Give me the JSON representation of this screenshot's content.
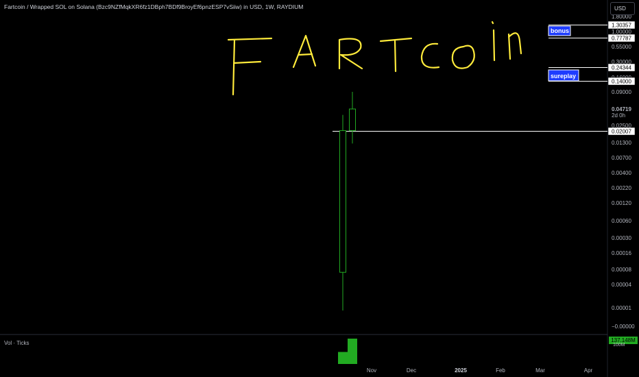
{
  "header": {
    "title": "Fartcoin / Wrapped SOL on Solana (Bzc9NZfMqkXR6fz1DBph7BDf9BroyEf6pnzESP7vSiiw) in USD, 1W, RAYDIUM",
    "currency": "USD"
  },
  "annotation": {
    "handwritten_text": "FARTCOIN",
    "color": "#ffeb3b"
  },
  "price_scale": {
    "ticks": [
      "1.80000",
      "1.00000",
      "0.55000",
      "0.30000",
      "0.16000",
      "0.09000",
      "0.04719",
      "0.02500",
      "0.01300",
      "0.00700",
      "0.00400",
      "0.00220",
      "0.00120",
      "0.00060",
      "0.00030",
      "0.00016",
      "0.00008",
      "0.00004",
      "0.00001",
      "−0.00000"
    ],
    "countdown": "2d 0h"
  },
  "price_tags": [
    {
      "label": "1.30357"
    },
    {
      "label": "0.77787"
    },
    {
      "label": "0.24344"
    },
    {
      "label": "0.14000"
    },
    {
      "label": "0.02007"
    }
  ],
  "badges": [
    {
      "label": "bonus"
    },
    {
      "label": "sureplay"
    }
  ],
  "time_axis": [
    "Nov",
    "Dec",
    "2025",
    "Feb",
    "Mar",
    "Apr"
  ],
  "volume": {
    "label": "Vol · Ticks",
    "value_tag": "137.148M",
    "unit": "100M"
  },
  "colors": {
    "up": "#22ab22",
    "badge_bg": "#1e3cff",
    "line": "#ffffff"
  },
  "chart_data": {
    "type": "candlestick",
    "title": "Fartcoin / Wrapped SOL on Solana (Bzc9NZfMqkXR6fz1DBph7BDf9BroyEf6pnzESP7vSiiw) in USD, 1W, RAYDIUM",
    "y_scale": "log",
    "candles": [
      {
        "open": 7e-05,
        "high": 0.0375,
        "low": 8.5e-06,
        "close": 0.0205
      },
      {
        "open": 0.0205,
        "high": 0.09,
        "low": 0.0125,
        "close": 0.04719
      }
    ],
    "volume": [
      {
        "value": 65000000
      },
      {
        "value": 137148000
      }
    ],
    "horizontal_lines": [
      1.30357,
      0.77787,
      0.24344,
      0.14,
      0.02007
    ],
    "current_price": 0.04719
  }
}
